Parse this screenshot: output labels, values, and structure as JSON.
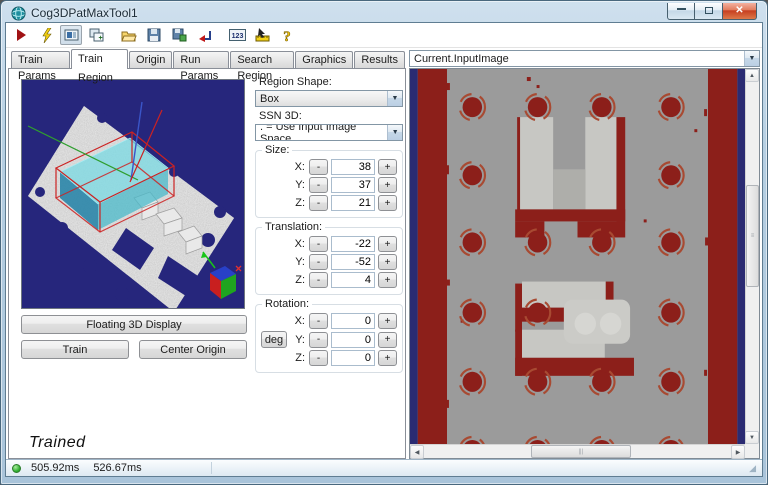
{
  "window": {
    "title": "Cog3DPatMaxTool1",
    "controls": {
      "minimize": "minimize",
      "maximize": "maximize",
      "close": "close"
    }
  },
  "toolbar": {
    "icons": [
      "run-icon",
      "trigger-icon",
      "image-display-toggle-icon",
      "floating-window-icon",
      "open-file-icon",
      "save-file-icon",
      "save-image-icon",
      "reset-icon",
      "numeric-display-icon",
      "measure-icon",
      "help-icon"
    ],
    "numeric_icon_text": "123",
    "help_glyph": "?"
  },
  "tabs": {
    "items": [
      "Train Params",
      "Train Region",
      "Origin",
      "Run Params",
      "Search Region",
      "Graphics",
      "Results"
    ],
    "active": "Train Region"
  },
  "left_panel": {
    "floating_button": "Floating 3D Display",
    "train_button": "Train",
    "center_origin_button": "Center Origin",
    "status_text": "Trained"
  },
  "region_controls": {
    "region_shape_label": "Region Shape:",
    "region_shape_value": "Box",
    "ssn3d_label": "SSN 3D:",
    "ssn3d_value": ". = Use Input Image Space",
    "minus": "-",
    "plus": "+",
    "deg_button": "deg",
    "size": {
      "title": "Size:",
      "x_label": "X:",
      "y_label": "Y:",
      "z_label": "Z:",
      "x": "38",
      "y": "37",
      "z": "21"
    },
    "translation": {
      "title": "Translation:",
      "x_label": "X:",
      "y_label": "Y:",
      "z_label": "Z:",
      "x": "-22",
      "y": "-52",
      "z": "4"
    },
    "rotation": {
      "title": "Rotation:",
      "x_label": "X:",
      "y_label": "Y:",
      "z_label": "Z:",
      "x": "0",
      "y": "0",
      "z": "0"
    }
  },
  "right_panel": {
    "image_selector": "Current.InputImage"
  },
  "status_bar": {
    "time1": "505.92ms",
    "time2": "526.67ms"
  },
  "colors": {
    "viewport_background": "#26267c",
    "image_gray": "#9b9b9b",
    "image_dark_red": "#8c1f1a",
    "image_navy": "#2b2b72",
    "status_green": "#35b335",
    "wireframe_red": "#cc2222",
    "train_box_cyan": "#7fd9e2"
  }
}
